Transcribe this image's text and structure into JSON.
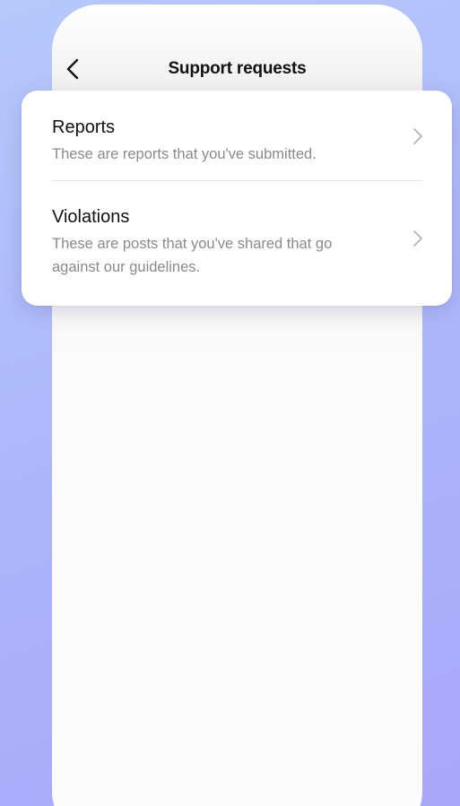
{
  "header": {
    "title": "Support requests",
    "back_icon": "chevron-left-icon"
  },
  "items": [
    {
      "title": "Reports",
      "description": "These are reports that you've submitted.",
      "icon": "chevron-right-icon"
    },
    {
      "title": "Violations",
      "description": "These are posts that you've shared that go against our guidelines.",
      "icon": "chevron-right-icon"
    }
  ],
  "colors": {
    "background_top": "#b7c9fb",
    "background_bottom": "#a9a6f8",
    "card": "#ffffff",
    "title_text": "#111111",
    "description_text": "#8a8a8a",
    "chevron": "#b0b0b0"
  }
}
